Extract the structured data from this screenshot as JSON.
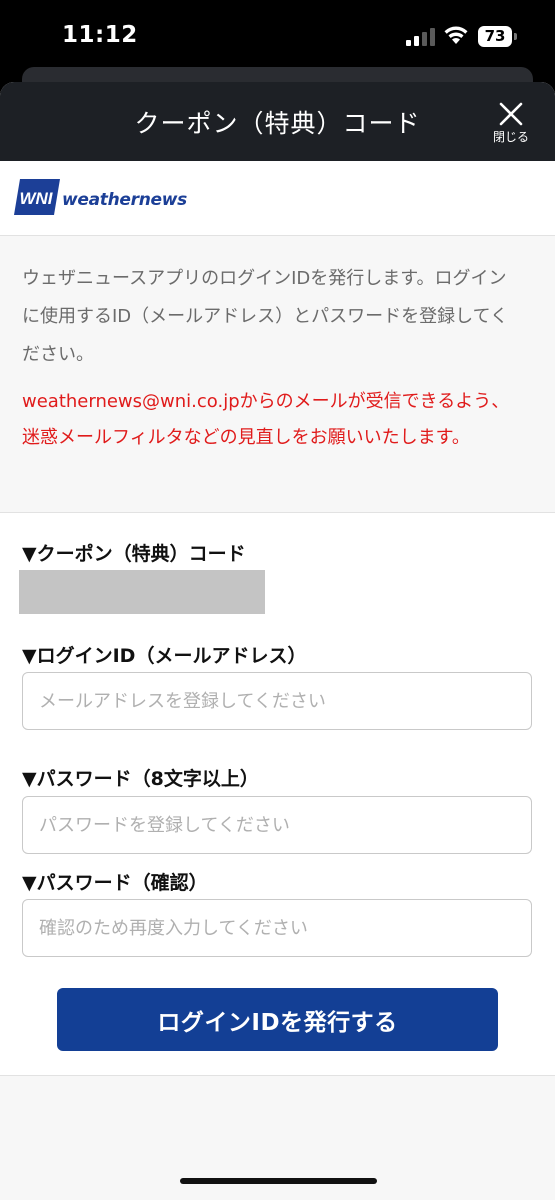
{
  "status_bar": {
    "time": "11:12",
    "battery": "73"
  },
  "header": {
    "title": "クーポン（特典）コード",
    "close_label": "閉じる"
  },
  "brand": {
    "logo_text": "WNI",
    "name": "weathernews"
  },
  "info": {
    "description": "ウェザニュースアプリのログインIDを発行します。ログインに使用するID（メールアドレス）とパスワードを登録してください。",
    "warning": "weathernews@wni.co.jpからのメールが受信できるよう、迷惑メールフィルタなどの見直しをお願いいたします。"
  },
  "form": {
    "coupon_label": "▼クーポン（特典）コード",
    "login_id_label": "▼ログインID（メールアドレス）",
    "login_id_placeholder": "メールアドレスを登録してください",
    "password_label": "▼パスワード（8文字以上）",
    "password_placeholder": "パスワードを登録してください",
    "confirm_label": "▼パスワード（確認）",
    "confirm_placeholder": "確認のため再度入力してください",
    "submit_label": "ログインIDを発行する"
  },
  "colors": {
    "header_bg": "#1d2025",
    "button_bg": "#133f95",
    "warning_text": "#e01b1b",
    "brand_blue": "#1c3f97"
  }
}
